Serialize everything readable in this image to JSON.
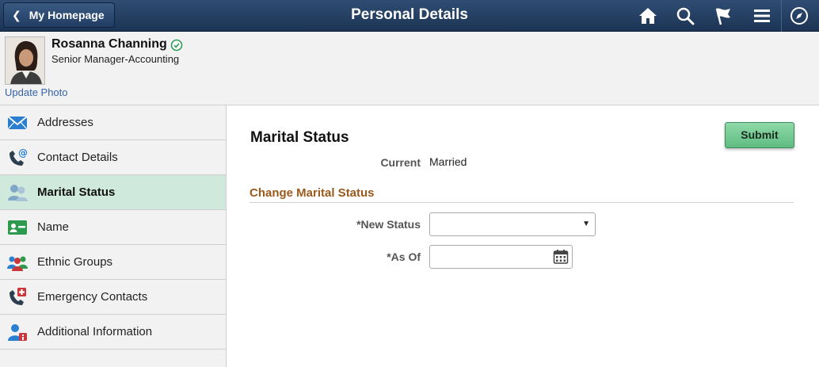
{
  "banner": {
    "back_label": "My Homepage",
    "title": "Personal Details",
    "icons": [
      "home-icon",
      "search-icon",
      "flag-icon",
      "menu-icon",
      "compass-icon"
    ]
  },
  "employee": {
    "name": "Rosanna Channing",
    "job_title": "Senior Manager-Accounting",
    "update_photo_label": "Update Photo",
    "status_icon": "check-circle-icon"
  },
  "sidebar": {
    "items": [
      {
        "label": "Addresses",
        "icon": "envelope-icon"
      },
      {
        "label": "Contact Details",
        "icon": "phone-at-icon"
      },
      {
        "label": "Marital Status",
        "icon": "people-icon",
        "selected": true
      },
      {
        "label": "Name",
        "icon": "id-card-icon"
      },
      {
        "label": "Ethnic Groups",
        "icon": "group-icon"
      },
      {
        "label": "Emergency Contacts",
        "icon": "emergency-phone-icon"
      },
      {
        "label": "Additional Information",
        "icon": "person-info-icon"
      }
    ]
  },
  "main": {
    "section_title": "Marital Status",
    "submit_label": "Submit",
    "current_label": "Current",
    "current_value": "Married",
    "change_title": "Change Marital Status",
    "new_status_label": "*New Status",
    "new_status_value": "",
    "as_of_label": "*As Of",
    "as_of_value": ""
  },
  "colors": {
    "banner": "#1c3455",
    "selected_nav": "#cfe9dc",
    "submit": "#5fbc81",
    "subheading": "#9a5a1c",
    "link": "#3662a8"
  }
}
